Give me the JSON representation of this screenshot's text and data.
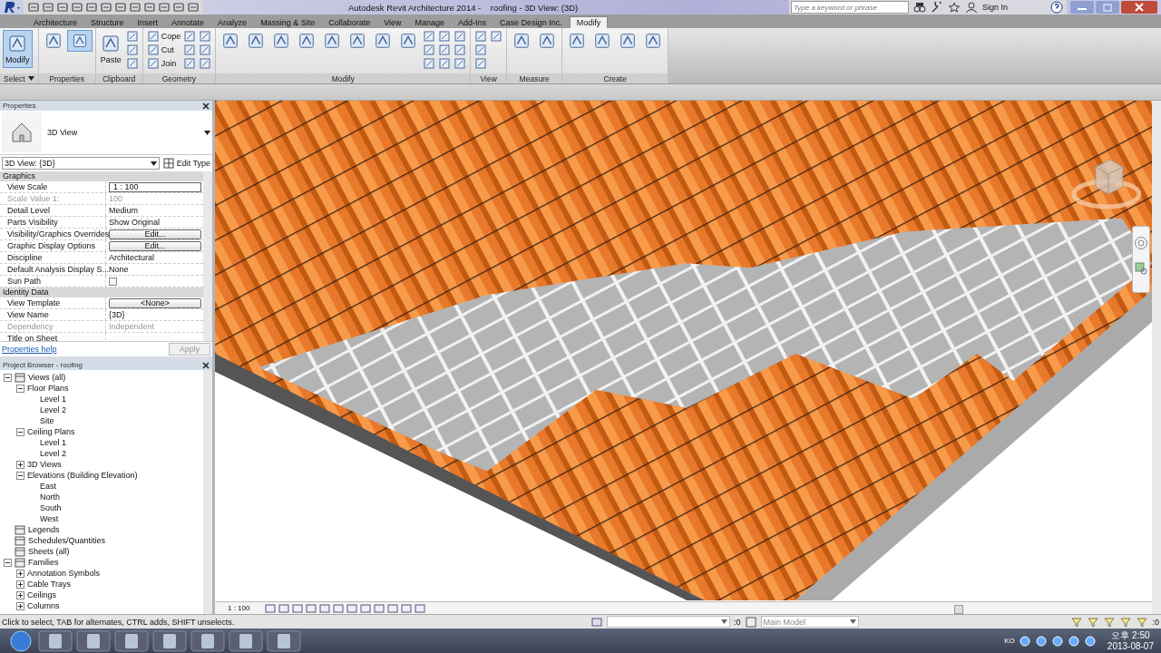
{
  "title_bar": {
    "title": "Autodesk Revit Architecture 2014 -    roofing - 3D View: (3D)",
    "search": {
      "placeholder": "Type a keyword or phrase"
    },
    "sign_in": "Sign In"
  },
  "tabs": [
    {
      "label": "Architecture",
      "selected": false
    },
    {
      "label": "Structure",
      "selected": false
    },
    {
      "label": "Insert",
      "selected": false
    },
    {
      "label": "Annotate",
      "selected": false
    },
    {
      "label": "Analyze",
      "selected": false
    },
    {
      "label": "Massing & Site",
      "selected": false
    },
    {
      "label": "Collaborate",
      "selected": false
    },
    {
      "label": "View",
      "selected": false
    },
    {
      "label": "Manage",
      "selected": false
    },
    {
      "label": "Add-Ins",
      "selected": false
    },
    {
      "label": "Case Design Inc.",
      "selected": false
    },
    {
      "label": "Modify",
      "selected": true
    }
  ],
  "ribbon": [
    {
      "title": "Select",
      "dropdown": true,
      "tools": [
        {
          "kind": "large",
          "label": "Modify",
          "selected": true
        }
      ]
    },
    {
      "title": "Properties",
      "dropdown": false,
      "tools": [
        {
          "kind": "large-icon",
          "selected": false
        },
        {
          "kind": "large-icon",
          "selected": true
        }
      ]
    },
    {
      "title": "Clipboard",
      "dropdown": false,
      "tools": [
        {
          "kind": "large",
          "label": "Paste",
          "selected": false
        },
        {
          "kind": "icon",
          "selected": false
        },
        {
          "kind": "icon",
          "selected": false
        },
        {
          "kind": "icon",
          "selected": false
        }
      ]
    },
    {
      "title": "Geometry",
      "dropdown": false,
      "tools": [
        {
          "kind": "small",
          "label": "Cope",
          "selected": false
        },
        {
          "kind": "small",
          "label": "Cut",
          "selected": false
        },
        {
          "kind": "small",
          "label": "Join",
          "selected": false
        },
        {
          "kind": "icon",
          "selected": false
        },
        {
          "kind": "icon",
          "selected": false
        },
        {
          "kind": "icon",
          "selected": false
        },
        {
          "kind": "icon",
          "selected": false
        },
        {
          "kind": "icon",
          "selected": false
        },
        {
          "kind": "icon",
          "selected": false
        }
      ]
    },
    {
      "title": "Modify",
      "dropdown": false,
      "tools": [
        {
          "kind": "large-icon",
          "selected": false
        },
        {
          "kind": "large-icon",
          "selected": false
        },
        {
          "kind": "large-icon",
          "selected": false
        },
        {
          "kind": "large-icon",
          "selected": false
        },
        {
          "kind": "large-icon",
          "selected": false
        },
        {
          "kind": "large-icon",
          "selected": false
        },
        {
          "kind": "large-icon",
          "selected": false
        },
        {
          "kind": "large-icon",
          "selected": false
        },
        {
          "kind": "icon",
          "selected": false
        },
        {
          "kind": "icon",
          "selected": false
        },
        {
          "kind": "icon",
          "selected": false
        },
        {
          "kind": "icon",
          "selected": false
        },
        {
          "kind": "icon",
          "selected": false
        },
        {
          "kind": "icon",
          "selected": false
        },
        {
          "kind": "icon",
          "selected": false
        },
        {
          "kind": "icon",
          "selected": false
        },
        {
          "kind": "icon",
          "selected": false
        }
      ]
    },
    {
      "title": "View",
      "dropdown": false,
      "tools": [
        {
          "kind": "icon",
          "selected": false
        },
        {
          "kind": "icon",
          "selected": false
        },
        {
          "kind": "icon",
          "selected": false
        },
        {
          "kind": "icon",
          "selected": false
        }
      ]
    },
    {
      "title": "Measure",
      "dropdown": false,
      "tools": [
        {
          "kind": "large-icon",
          "selected": false
        },
        {
          "kind": "large-icon",
          "selected": false
        }
      ]
    },
    {
      "title": "Create",
      "dropdown": false,
      "tools": [
        {
          "kind": "large-icon",
          "selected": false
        },
        {
          "kind": "large-icon",
          "selected": false
        },
        {
          "kind": "large-icon",
          "selected": false
        },
        {
          "kind": "large-icon",
          "selected": false
        }
      ]
    }
  ],
  "properties": {
    "title": "Properties",
    "type_name": "3D View",
    "instance": "3D View: {3D}",
    "edit_type": "Edit Type",
    "groups": [
      {
        "title": "Graphics",
        "rows": [
          {
            "name": "View Scale",
            "value": "1 : 100",
            "kind": "field",
            "disabled": false
          },
          {
            "name": "Scale Value    1:",
            "value": "100",
            "kind": "text",
            "disabled": true
          },
          {
            "name": "Detail Level",
            "value": "Medium",
            "kind": "text",
            "disabled": false
          },
          {
            "name": "Parts Visibility",
            "value": "Show Original",
            "kind": "text",
            "disabled": false
          },
          {
            "name": "Visibility/Graphics Overrides",
            "value": "Edit...",
            "kind": "button",
            "disabled": false
          },
          {
            "name": "Graphic Display Options",
            "value": "Edit...",
            "kind": "button",
            "disabled": false
          },
          {
            "name": "Discipline",
            "value": "Architectural",
            "kind": "text",
            "disabled": false
          },
          {
            "name": "Default Analysis Display S...",
            "value": "None",
            "kind": "text",
            "disabled": false
          },
          {
            "name": "Sun Path",
            "kind": "checkbox",
            "checked": false,
            "disabled": false
          }
        ]
      },
      {
        "title": "Identity Data",
        "rows": [
          {
            "name": "View Template",
            "value": "<None>",
            "kind": "button",
            "disabled": false
          },
          {
            "name": "View Name",
            "value": "{3D}",
            "kind": "text",
            "disabled": false
          },
          {
            "name": "Dependency",
            "value": "Independent",
            "kind": "text",
            "disabled": true
          },
          {
            "name": "Title on Sheet",
            "value": "",
            "kind": "text",
            "disabled": false
          }
        ]
      }
    ],
    "help": "Properties help",
    "apply": "Apply"
  },
  "project_browser": {
    "title": "Project Browser - roofing",
    "tree": [
      {
        "label": "Views (all)",
        "expanded": true,
        "children": [
          {
            "label": "Floor Plans",
            "expanded": true,
            "children": [
              {
                "label": "Level 1"
              },
              {
                "label": "Level 2"
              },
              {
                "label": "Site"
              }
            ]
          },
          {
            "label": "Ceiling Plans",
            "expanded": true,
            "children": [
              {
                "label": "Level 1"
              },
              {
                "label": "Level 2"
              }
            ]
          },
          {
            "label": "3D Views",
            "expanded": false
          },
          {
            "label": "Elevations (Building Elevation)",
            "expanded": true,
            "children": [
              {
                "label": "East"
              },
              {
                "label": "North"
              },
              {
                "label": "South"
              },
              {
                "label": "West"
              }
            ]
          }
        ]
      },
      {
        "label": "Legends"
      },
      {
        "label": "Schedules/Quantities"
      },
      {
        "label": "Sheets (all)"
      },
      {
        "label": "Families",
        "expanded": true,
        "children": [
          {
            "label": "Annotation Symbols",
            "expanded": false
          },
          {
            "label": "Cable Trays",
            "expanded": false
          },
          {
            "label": "Ceilings",
            "expanded": false
          },
          {
            "label": "Columns",
            "expanded": false
          }
        ]
      }
    ]
  },
  "view_bar": {
    "scale": "1 : 100"
  },
  "status_bar": {
    "message": "Click to select, TAB for alternates, CTRL adds, SHIFT unselects.",
    "selection_count": ":0",
    "workset": "Main Model",
    "filter_count": ":0"
  },
  "taskbar": {
    "language": "KO",
    "time": "오후 2:50",
    "date": "2013-08-07"
  }
}
